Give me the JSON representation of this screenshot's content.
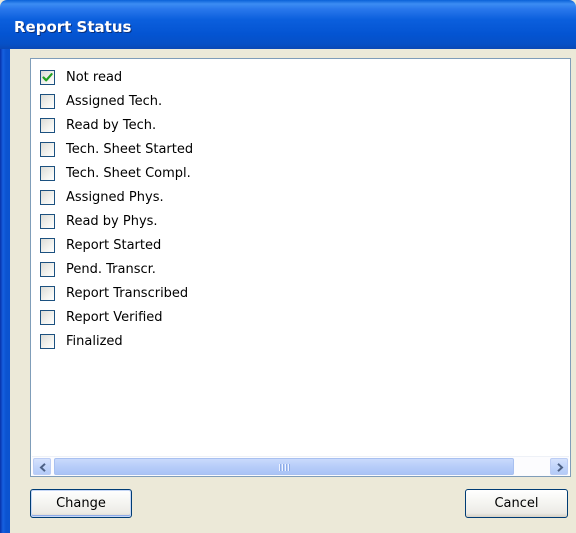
{
  "window": {
    "title": "Report Status"
  },
  "status_list": {
    "items": [
      {
        "label": "Not read",
        "checked": true
      },
      {
        "label": "Assigned Tech.",
        "checked": false
      },
      {
        "label": "Read by Tech.",
        "checked": false
      },
      {
        "label": "Tech. Sheet Started",
        "checked": false
      },
      {
        "label": "Tech. Sheet Compl.",
        "checked": false
      },
      {
        "label": "Assigned Phys.",
        "checked": false
      },
      {
        "label": "Read by Phys.",
        "checked": false
      },
      {
        "label": "Report Started",
        "checked": false
      },
      {
        "label": "Pend. Transcr.",
        "checked": false
      },
      {
        "label": "Report Transcribed",
        "checked": false
      },
      {
        "label": "Report Verified",
        "checked": false
      },
      {
        "label": "Finalized",
        "checked": false
      }
    ]
  },
  "buttons": {
    "change_label": "Change",
    "cancel_label": "Cancel"
  },
  "icons": {
    "checkmark": "checkmark-icon",
    "scroll_left": "arrow-left-icon",
    "scroll_right": "arrow-right-icon"
  },
  "colors": {
    "title_bar": "#0454d2",
    "checkmark": "#21a121"
  }
}
